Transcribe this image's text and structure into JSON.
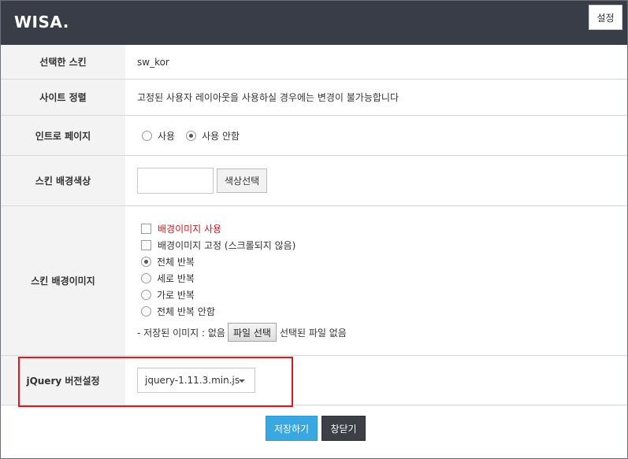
{
  "header": {
    "logo": "WISA.",
    "settings_label": "설정"
  },
  "rows": {
    "skin": {
      "label": "선택한 스킨",
      "value": "sw_kor"
    },
    "align": {
      "label": "사이트 정렬",
      "value": "고정된 사용자 레이아웃을 사용하실 경우에는 변경이 불가능합니다"
    },
    "intro": {
      "label": "인트로 페이지",
      "options": [
        "사용",
        "사용 안함"
      ],
      "selected": "사용 안함"
    },
    "bgcolor": {
      "label": "스킨 배경색상",
      "input_value": "",
      "pick_label": "색상선택"
    },
    "bgimage": {
      "label": "스킨 배경이미지",
      "use_label": "배경이미지 사용",
      "fixed_label": "배경이미지 고정 (스크롤되지 않음)",
      "repeat_options": [
        "전체 반복",
        "세로 반복",
        "가로 반복",
        "전체 반복 안함"
      ],
      "repeat_selected": "전체 반복",
      "saved_prefix": "- 저장된 이미지 : 없음",
      "file_button": "파일 선택",
      "file_status": "선택된 파일 없음"
    },
    "jquery": {
      "label": "jQuery 버전설정",
      "selected": "jquery-1.11.3.min.js"
    }
  },
  "footer": {
    "save_label": "저장하기",
    "close_label": "창닫기"
  },
  "colors": {
    "header_bg": "#383d47",
    "save_bg": "#39a8e1",
    "close_bg": "#3c3f46",
    "highlight": "#e8141b",
    "label_bg": "#f3f3f3"
  }
}
